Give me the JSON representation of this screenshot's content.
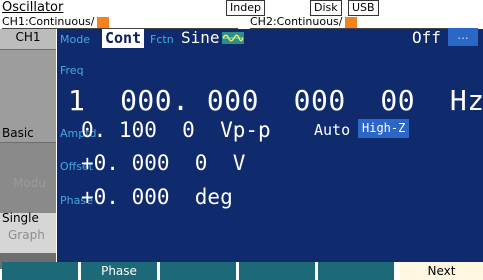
{
  "header": {
    "title": "Oscillator",
    "mode_indicator": "Indep",
    "disk_label": "Disk",
    "usb_label": "USB",
    "ch1_status": "CH1:Continuous/",
    "ch2_status": "CH2:Continuous/",
    "channel_color": "#f58220"
  },
  "sidebar": {
    "channel_tab": "CH1",
    "basic_label": "Basic",
    "modu_label": "Modu",
    "single_label": "Single",
    "graph_label": "Graph"
  },
  "params": {
    "mode_label": "Mode",
    "mode_value": "Cont",
    "fctn_label": "Fctn",
    "fctn_value": "Sine",
    "waveform_icon": "sine-wave-icon",
    "output_state": "Off",
    "more_button": "...",
    "freq_label": "Freq",
    "freq_value": "1  000. 000  000  00  Hz",
    "amptd_label": "Amptd",
    "amptd_value": "0. 100  0  Vp-p",
    "auto_label": "Auto",
    "load_value": "High-Z",
    "offset_label": "Offset",
    "offset_value": "+0. 000  0  V",
    "phase_label": "Phase",
    "phase_value": "+0. 000  deg"
  },
  "softkeys": [
    "",
    "Phase",
    "",
    "",
    "",
    "Next"
  ],
  "colors": {
    "panel_bg": "#102a6e",
    "label_blue": "#45a8e0",
    "softkey_teal": "#1c6a78",
    "accent_blue": "#2b67c6"
  }
}
